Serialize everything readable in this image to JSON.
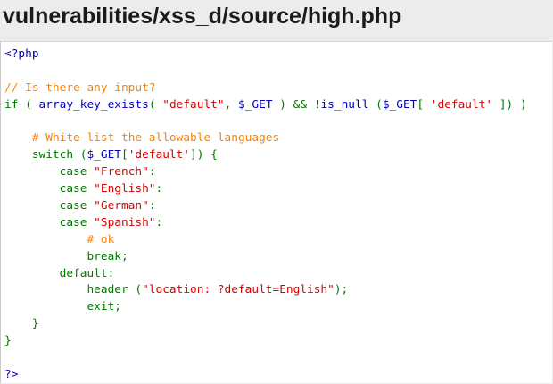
{
  "page": {
    "title": "vulnerabilities/xss_d/source/high.php"
  },
  "colors": {
    "default": "#0000bb",
    "keyword": "#007700",
    "string": "#dd0000",
    "comment": "#ff8000",
    "html": "#000000"
  },
  "code": {
    "language": "php",
    "lines": [
      [
        {
          "t": "<?php",
          "c": "default"
        }
      ],
      [],
      [
        {
          "t": "// Is there any input?",
          "c": "comment"
        }
      ],
      [
        {
          "t": "if ( ",
          "c": "keyword"
        },
        {
          "t": "array_key_exists",
          "c": "default"
        },
        {
          "t": "( ",
          "c": "keyword"
        },
        {
          "t": "\"default\"",
          "c": "string"
        },
        {
          "t": ", ",
          "c": "keyword"
        },
        {
          "t": "$_GET ",
          "c": "default"
        },
        {
          "t": ") && !",
          "c": "keyword"
        },
        {
          "t": "is_null ",
          "c": "default"
        },
        {
          "t": "(",
          "c": "keyword"
        },
        {
          "t": "$_GET",
          "c": "default"
        },
        {
          "t": "[ ",
          "c": "keyword"
        },
        {
          "t": "'default' ",
          "c": "string"
        },
        {
          "t": "]) )",
          "c": "keyword"
        }
      ],
      [],
      [
        {
          "t": "    ",
          "c": "keyword"
        },
        {
          "t": "# White list the allowable languages",
          "c": "comment"
        }
      ],
      [
        {
          "t": "    switch (",
          "c": "keyword"
        },
        {
          "t": "$_GET",
          "c": "default"
        },
        {
          "t": "[",
          "c": "keyword"
        },
        {
          "t": "'default'",
          "c": "string"
        },
        {
          "t": "]) {",
          "c": "keyword"
        }
      ],
      [
        {
          "t": "        case ",
          "c": "keyword"
        },
        {
          "t": "\"French\"",
          "c": "string"
        },
        {
          "t": ":",
          "c": "keyword"
        }
      ],
      [
        {
          "t": "        case ",
          "c": "keyword"
        },
        {
          "t": "\"English\"",
          "c": "string"
        },
        {
          "t": ":",
          "c": "keyword"
        }
      ],
      [
        {
          "t": "        case ",
          "c": "keyword"
        },
        {
          "t": "\"German\"",
          "c": "string"
        },
        {
          "t": ":",
          "c": "keyword"
        }
      ],
      [
        {
          "t": "        case ",
          "c": "keyword"
        },
        {
          "t": "\"Spanish\"",
          "c": "string"
        },
        {
          "t": ":",
          "c": "keyword"
        }
      ],
      [
        {
          "t": "            ",
          "c": "keyword"
        },
        {
          "t": "# ok",
          "c": "comment"
        }
      ],
      [
        {
          "t": "            break;",
          "c": "keyword"
        }
      ],
      [
        {
          "t": "        default:",
          "c": "keyword"
        }
      ],
      [
        {
          "t": "            header ",
          "c": "keyword"
        },
        {
          "t": "(",
          "c": "keyword"
        },
        {
          "t": "\"location: ?default=English\"",
          "c": "string"
        },
        {
          "t": ");",
          "c": "keyword"
        }
      ],
      [
        {
          "t": "            exit;",
          "c": "keyword"
        }
      ],
      [
        {
          "t": "    }",
          "c": "keyword"
        }
      ],
      [
        {
          "t": "}",
          "c": "keyword"
        }
      ],
      [],
      [
        {
          "t": "?>",
          "c": "default"
        }
      ]
    ]
  }
}
